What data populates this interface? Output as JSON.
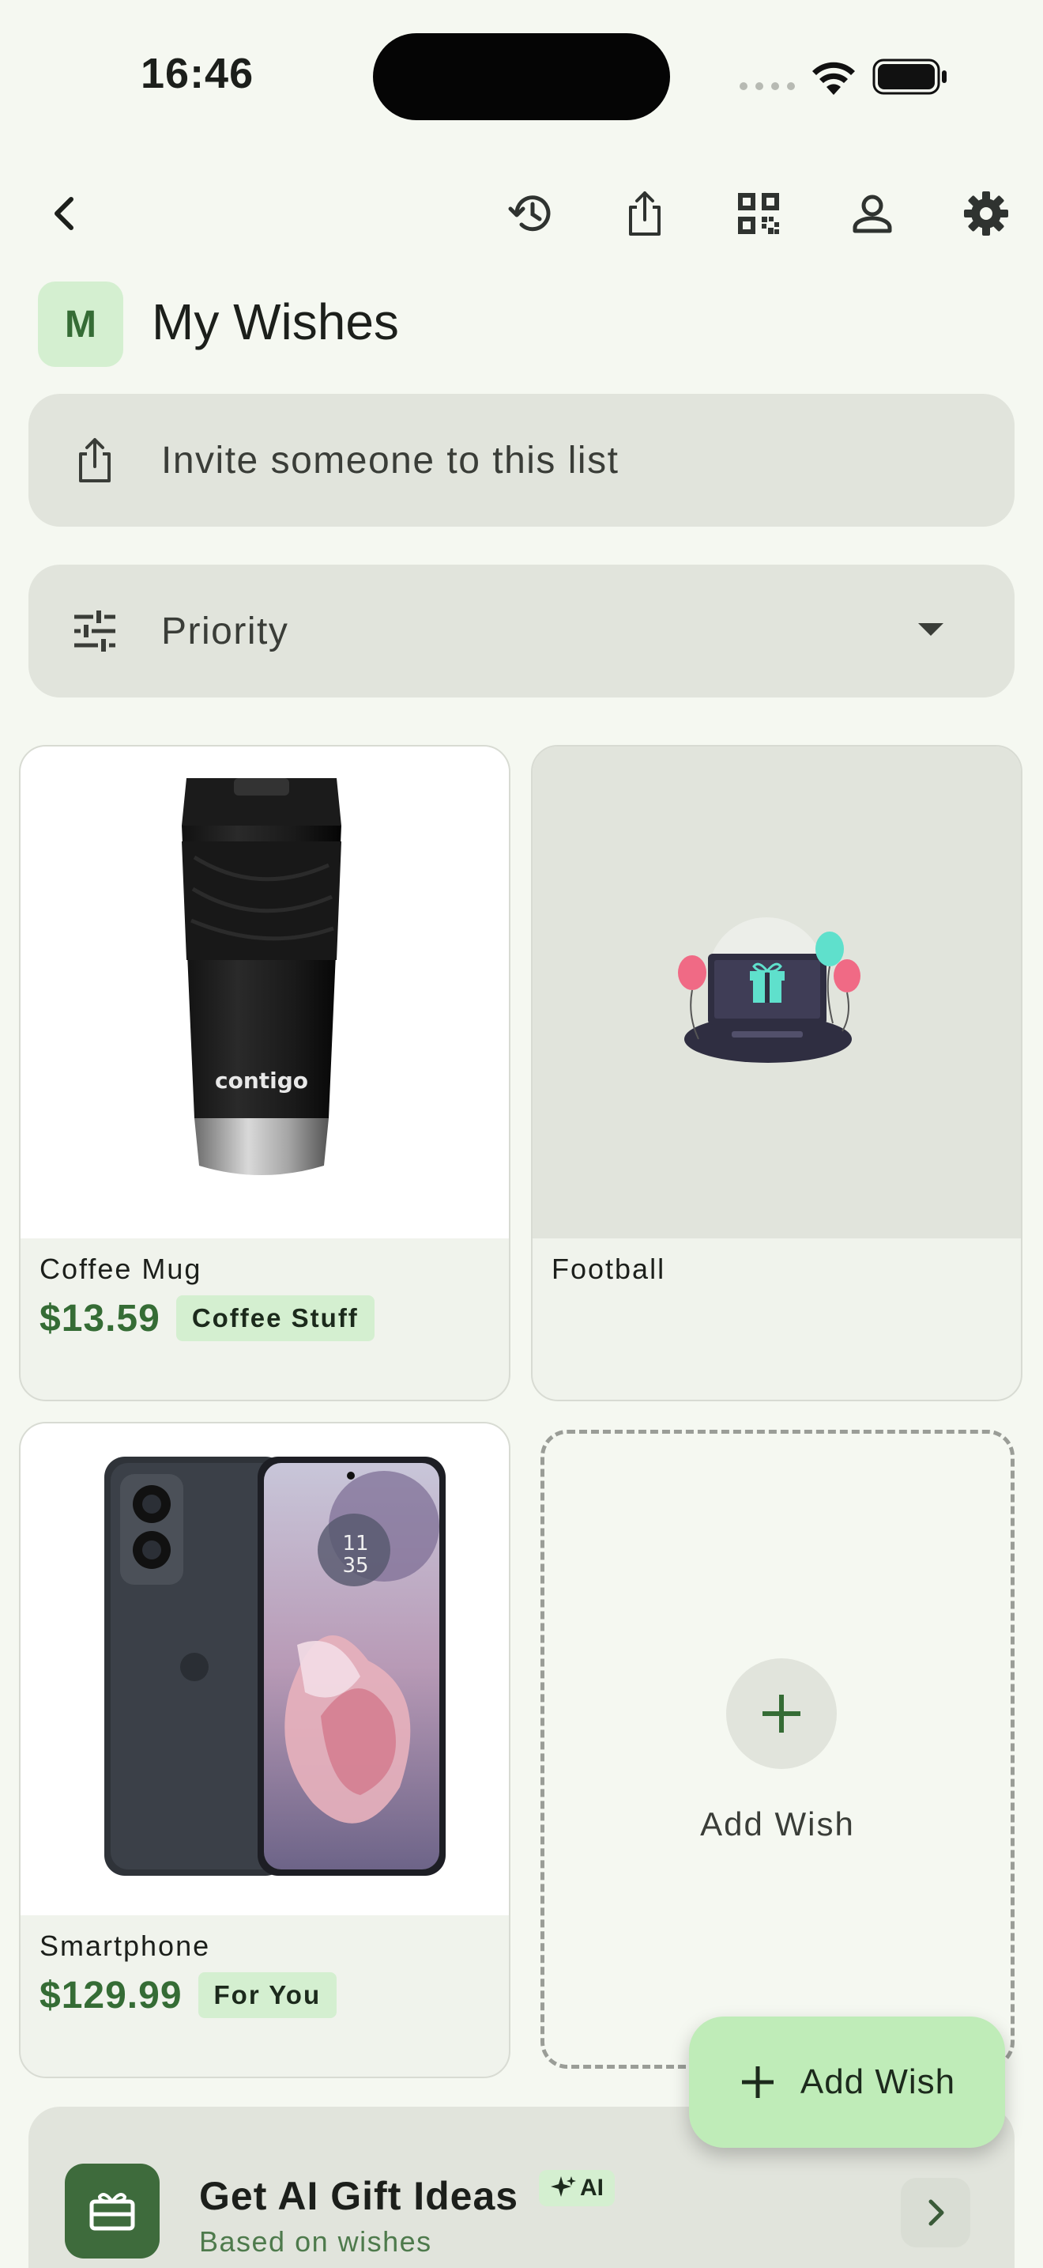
{
  "status_bar": {
    "time": "16:46"
  },
  "header": {
    "avatar_letter": "M",
    "title": "My Wishes",
    "icons": [
      "back-icon",
      "history-icon",
      "share-icon",
      "qr-code-icon",
      "profile-icon",
      "gear-icon"
    ]
  },
  "invite": {
    "label": "Invite someone to this list"
  },
  "sort": {
    "selected": "Priority"
  },
  "wishes": [
    {
      "name": "Coffee Mug",
      "price": "$13.59",
      "tag": "Coffee Stuff"
    },
    {
      "name": "Football",
      "price": "",
      "tag": ""
    },
    {
      "name": "Smartphone",
      "price": "$129.99",
      "tag": "For You"
    }
  ],
  "add_card": {
    "label": "Add Wish"
  },
  "ai_card": {
    "title": "Get AI Gift Ideas",
    "badge": "AI",
    "subtitle": "Based on wishes"
  },
  "fab": {
    "label": "Add Wish"
  },
  "colors": {
    "background": "#f5f8f1",
    "accent": "#356c35",
    "surface": "#e1e4dc",
    "chip": "#d4efd0",
    "fab": "#bfecb8"
  }
}
